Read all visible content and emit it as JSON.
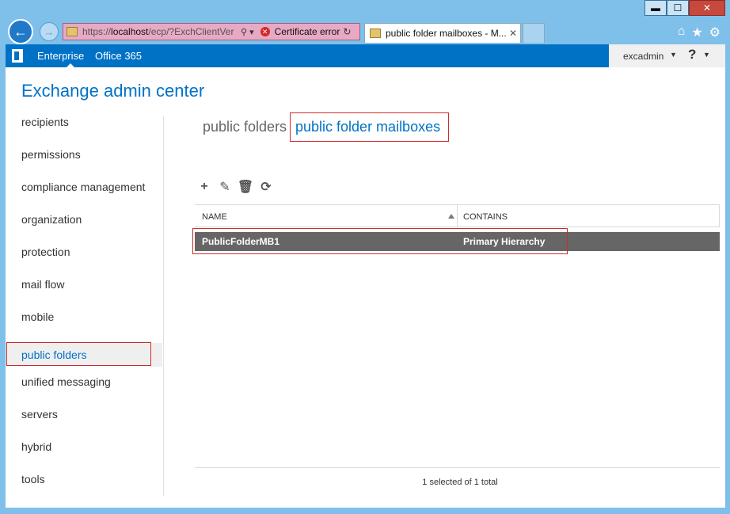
{
  "window": {
    "minimize_label": "▬",
    "maximize_label": "☐",
    "close_label": "✕"
  },
  "browser": {
    "address_scheme": "https://",
    "address_host": "localhost",
    "address_path": "/ecp/?ExchClientVer",
    "search_icon": "⚲ ▾",
    "cert_icon": "✕",
    "cert_error": "Certificate error",
    "refresh_icon": "↻",
    "tab_title": "public folder mailboxes - M...",
    "tab_close": "✕",
    "home_icon": "⌂",
    "favorites_icon": "★",
    "tools_icon": "⚙",
    "back_icon": "←",
    "forward_icon": "→"
  },
  "o365": {
    "enterprise": "Enterprise",
    "office365": "Office 365",
    "user": "excadmin",
    "user_caret": "▼",
    "help": "?",
    "help_caret": "▼"
  },
  "app_title": "Exchange admin center",
  "sidebar": {
    "items": [
      "recipients",
      "permissions",
      "compliance management",
      "organization",
      "protection",
      "mail flow",
      "mobile",
      "public folders",
      "unified messaging",
      "servers",
      "hybrid",
      "tools"
    ],
    "active": "public folders"
  },
  "pivots": {
    "inactive": "public folders",
    "active": "public folder mailboxes"
  },
  "toolbar": {
    "add": "+",
    "edit": "✎",
    "delete": "🗑",
    "refresh": "⟳"
  },
  "grid": {
    "columns": [
      "NAME",
      "CONTAINS"
    ],
    "rows": [
      {
        "name": "PublicFolderMB1",
        "contains": "Primary Hierarchy"
      }
    ]
  },
  "status": "1 selected of 1 total",
  "colors": {
    "accent": "#0072c6",
    "highlight": "#d02b2b",
    "selected_row": "#666666"
  }
}
